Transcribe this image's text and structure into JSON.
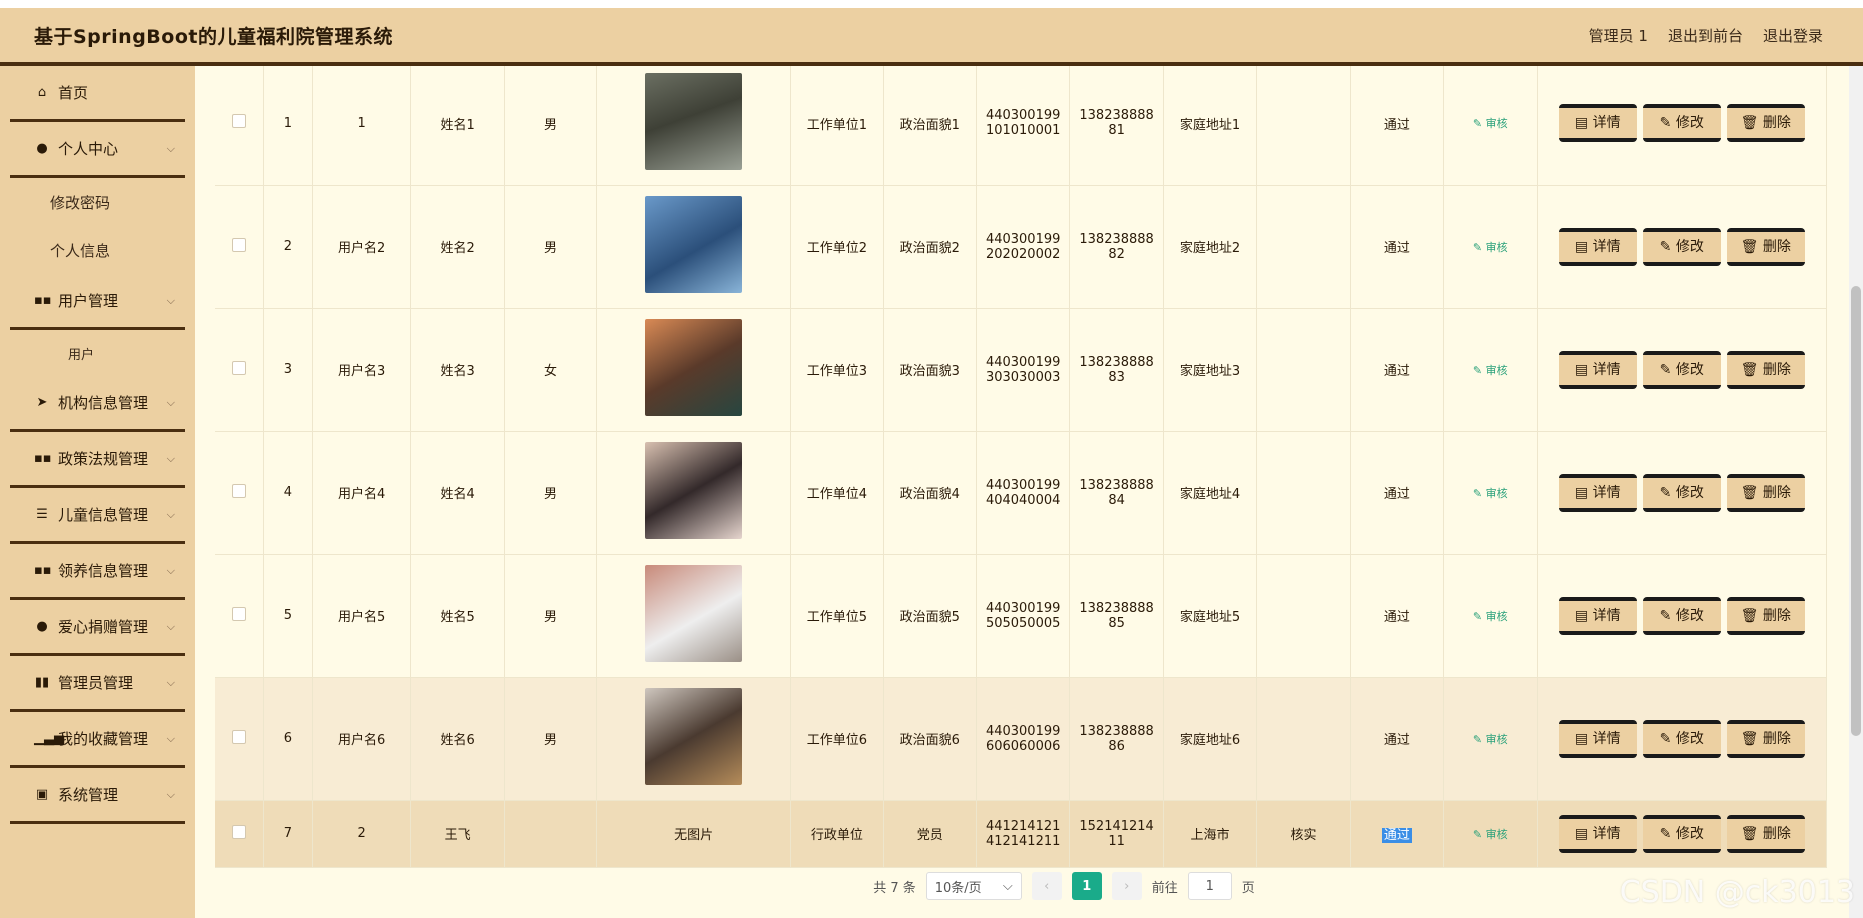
{
  "header": {
    "title": "基于SpringBoot的儿童福利院管理系统",
    "user": "管理员 1",
    "to_front": "退出到前台",
    "logout": "退出登录"
  },
  "sidebar": {
    "items": [
      {
        "label": "首页",
        "icon": "home-icon"
      },
      {
        "label": "个人中心",
        "icon": "user-icon"
      },
      {
        "label": "修改密码"
      },
      {
        "label": "个人信息"
      },
      {
        "label": "用户管理",
        "icon": "grid-icon"
      },
      {
        "label": "用户"
      },
      {
        "label": "机构信息管理",
        "icon": "send-icon"
      },
      {
        "label": "政策法规管理",
        "icon": "grid-icon"
      },
      {
        "label": "儿童信息管理",
        "icon": "list-icon"
      },
      {
        "label": "领养信息管理",
        "icon": "grid-icon"
      },
      {
        "label": "爱心捐赠管理",
        "icon": "user-icon"
      },
      {
        "label": "管理员管理",
        "icon": "chart-icon"
      },
      {
        "label": "我的收藏管理",
        "icon": "bar-chart-icon"
      },
      {
        "label": "系统管理",
        "icon": "clipboard-icon"
      }
    ]
  },
  "table": {
    "rows": [
      {
        "index": "1",
        "username": "1",
        "name": "姓名1",
        "gender": "男",
        "photo": "",
        "workplace": "工作单位1",
        "political": "政治面貌1",
        "id_card": "440300199 101010001",
        "phone": "138238888 81",
        "address": "家庭地址1",
        "remark": "",
        "status": "通过"
      },
      {
        "index": "2",
        "username": "用户名2",
        "name": "姓名2",
        "gender": "男",
        "photo": "",
        "workplace": "工作单位2",
        "political": "政治面貌2",
        "id_card": "440300199 202020002",
        "phone": "138238888 82",
        "address": "家庭地址2",
        "remark": "",
        "status": "通过"
      },
      {
        "index": "3",
        "username": "用户名3",
        "name": "姓名3",
        "gender": "女",
        "photo": "",
        "workplace": "工作单位3",
        "political": "政治面貌3",
        "id_card": "440300199 303030003",
        "phone": "138238888 83",
        "address": "家庭地址3",
        "remark": "",
        "status": "通过"
      },
      {
        "index": "4",
        "username": "用户名4",
        "name": "姓名4",
        "gender": "男",
        "photo": "",
        "workplace": "工作单位4",
        "political": "政治面貌4",
        "id_card": "440300199 404040004",
        "phone": "138238888 84",
        "address": "家庭地址4",
        "remark": "",
        "status": "通过"
      },
      {
        "index": "5",
        "username": "用户名5",
        "name": "姓名5",
        "gender": "男",
        "photo": "",
        "workplace": "工作单位5",
        "political": "政治面貌5",
        "id_card": "440300199 505050005",
        "phone": "138238888 85",
        "address": "家庭地址5",
        "remark": "",
        "status": "通过"
      },
      {
        "index": "6",
        "username": "用户名6",
        "name": "姓名6",
        "gender": "男",
        "photo": "",
        "workplace": "工作单位6",
        "political": "政治面貌6",
        "id_card": "440300199 606060006",
        "phone": "138238888 86",
        "address": "家庭地址6",
        "remark": "",
        "status": "通过"
      },
      {
        "index": "7",
        "username": "2",
        "name": "王飞",
        "gender": "",
        "photo": "无图片",
        "workplace": "行政单位",
        "political": "党员",
        "id_card": "441214121 412141211",
        "phone": "152141214 11",
        "address": "上海市",
        "remark": "核实",
        "status": "通过"
      }
    ],
    "audit_label": "审核",
    "detail_label": "详情",
    "edit_label": "修改",
    "delete_label": "删除"
  },
  "pager": {
    "total": "共 7 条",
    "page_size": "10条/页",
    "current": "1",
    "goto": "前往",
    "goto_value": "1",
    "page_unit": "页"
  },
  "watermark": "CSDN @ck3013"
}
